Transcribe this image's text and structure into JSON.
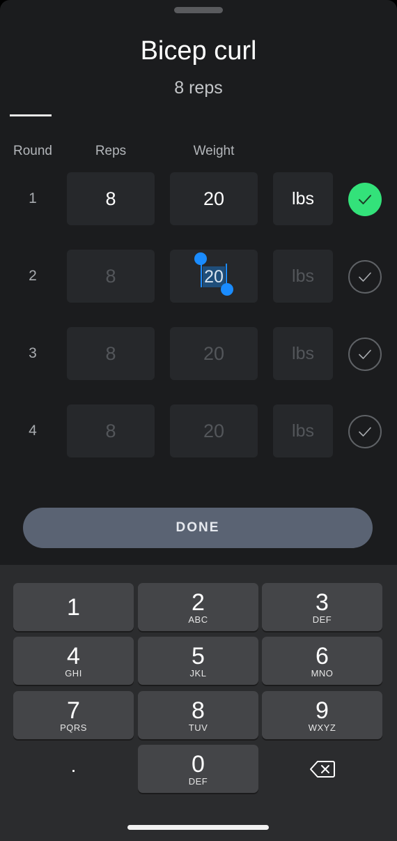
{
  "header": {
    "title": "Bicep curl",
    "subtitle": "8 reps"
  },
  "columns": {
    "round": "Round",
    "reps": "Reps",
    "weight": "Weight"
  },
  "rows": [
    {
      "round": "1",
      "reps": "8",
      "weight": "20",
      "unit": "lbs",
      "completed": true
    },
    {
      "round": "2",
      "reps": "8",
      "weight": "20",
      "unit": "lbs",
      "completed": false,
      "editing": true
    },
    {
      "round": "3",
      "reps": "8",
      "weight": "20",
      "unit": "lbs",
      "completed": false
    },
    {
      "round": "4",
      "reps": "8",
      "weight": "20",
      "unit": "lbs",
      "completed": false
    }
  ],
  "done_label": "DONE",
  "keypad": [
    {
      "num": "1",
      "letters": ""
    },
    {
      "num": "2",
      "letters": "ABC"
    },
    {
      "num": "3",
      "letters": "DEF"
    },
    {
      "num": "4",
      "letters": "GHI"
    },
    {
      "num": "5",
      "letters": "JKL"
    },
    {
      "num": "6",
      "letters": "MNO"
    },
    {
      "num": "7",
      "letters": "PQRS"
    },
    {
      "num": "8",
      "letters": "TUV"
    },
    {
      "num": "9",
      "letters": "WXYZ"
    },
    {
      "num": ".",
      "letters": ""
    },
    {
      "num": "0",
      "letters": "DEF"
    }
  ],
  "icons": {
    "check": "check-icon",
    "backspace": "backspace-icon"
  },
  "colors": {
    "accent_green": "#33e27a",
    "selection_blue": "#1a8cff",
    "done_button": "#5a6373"
  }
}
